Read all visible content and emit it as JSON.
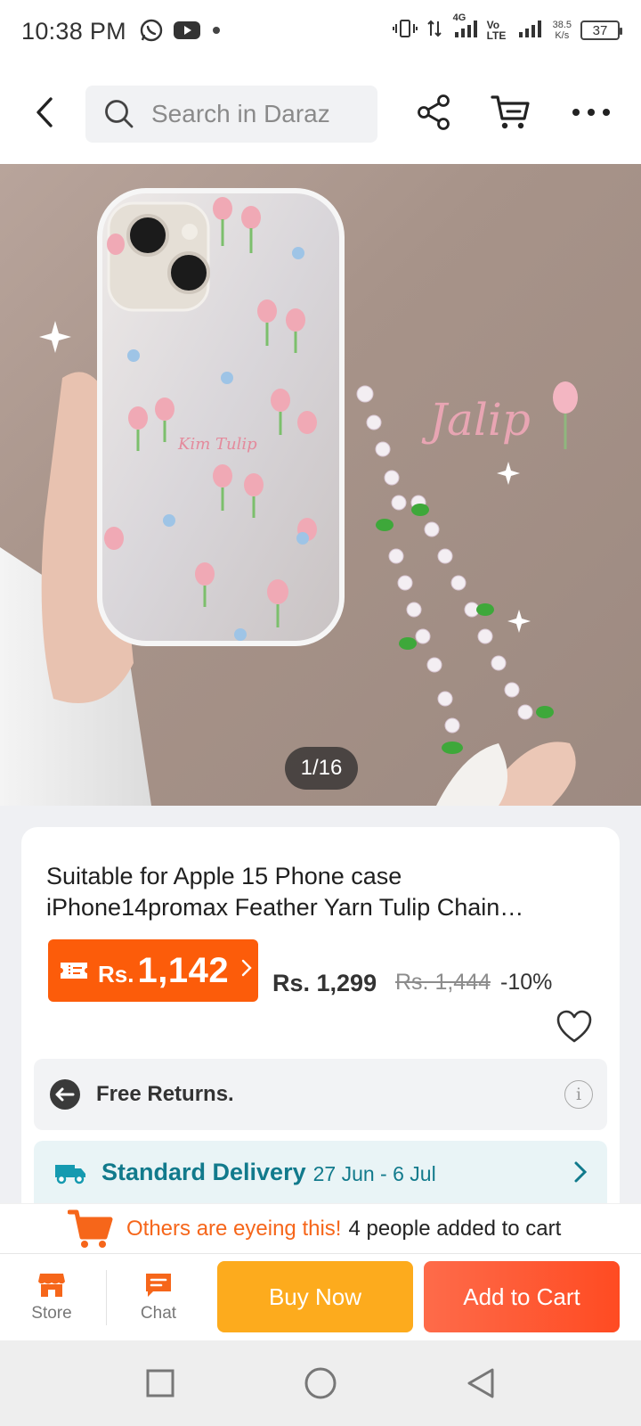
{
  "status_bar": {
    "time": "10:38 PM",
    "net_speed_value": "38.5",
    "net_speed_unit": "K/s",
    "battery": "37",
    "network_labels": [
      "4G",
      "Vo LTE"
    ]
  },
  "header": {
    "search_placeholder": "Search in Daraz"
  },
  "product": {
    "image_counter": "1/16",
    "image_text": "Jalip",
    "title": "Suitable for Apple 15 Phone case iPhone14promax Feather Yarn Tulip Chain…",
    "coupon_currency": "Rs.",
    "coupon_price": "1,142",
    "current_price": "Rs. 1,299",
    "original_price": "Rs. 1,444",
    "discount": "-10%"
  },
  "services": {
    "returns_label": "Free Returns.",
    "delivery_label": "Standard Delivery",
    "delivery_dates": "27 Jun - 6 Jul"
  },
  "eyeing": {
    "highlight": "Others are eyeing this!",
    "rest": "4 people added to cart"
  },
  "bottom_bar": {
    "store_label": "Store",
    "chat_label": "Chat",
    "buy_now": "Buy Now",
    "add_to_cart": "Add to Cart"
  },
  "colors": {
    "brand_orange": "#fc5c0a",
    "buy_now": "#fdab1d",
    "add_to_cart": "#ff4b22",
    "delivery_teal": "#117a8c"
  }
}
